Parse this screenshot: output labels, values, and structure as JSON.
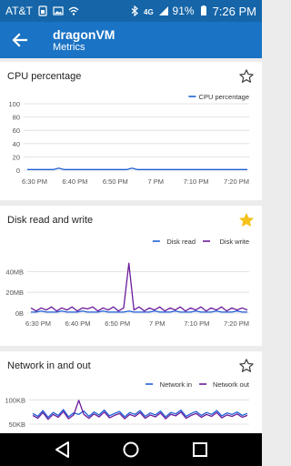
{
  "status_bar": {
    "carrier": "AT&T",
    "battery": "91%",
    "time": "7:26 PM",
    "icons": [
      "sim-icon",
      "image-icon",
      "wifi-icon",
      "bluetooth-icon",
      "4g-icon",
      "signal-icon",
      "battery-icon"
    ]
  },
  "app_bar": {
    "title": "dragonVM",
    "subtitle": "Metrics",
    "back_icon": "arrow-back-icon"
  },
  "cards": {
    "cpu": {
      "title": "CPU percentage",
      "starred": false
    },
    "disk": {
      "title": "Disk read and write",
      "starred": true
    },
    "network": {
      "title": "Network in and out",
      "starred": false
    }
  },
  "colors": {
    "status_bar": "#1565a8",
    "app_bar": "#1a73c4",
    "series_blue": "#1f5fd6",
    "series_purple": "#6a1b9a",
    "star_gold": "#f5c21b",
    "background": "#ececec"
  },
  "chart_data": [
    {
      "id": "cpu",
      "type": "line",
      "title": "CPU percentage",
      "ylim": [
        0,
        100
      ],
      "yticks": [
        "100",
        "80",
        "60",
        "40",
        "20",
        "0"
      ],
      "xticks": [
        "6:30 PM",
        "6:40 PM",
        "6:50 PM",
        "7 PM",
        "7:10 PM",
        "7:20 PM"
      ],
      "legend_position": "top-right",
      "grid": true,
      "series": [
        {
          "name": "CPU percentage",
          "color": "#1f5fd6",
          "values": [
            1,
            1,
            1,
            1,
            1,
            1,
            3,
            1,
            1,
            1,
            1,
            1,
            1,
            1,
            1,
            1,
            1,
            1,
            1,
            1,
            3,
            1,
            1,
            1,
            1,
            1,
            1,
            1,
            1,
            1,
            1,
            1,
            1,
            1,
            1,
            1,
            1,
            1,
            1,
            1,
            1,
            1,
            1
          ]
        }
      ]
    },
    {
      "id": "disk",
      "type": "line",
      "title": "Disk read and write",
      "ylim": [
        0,
        50
      ],
      "yticks": [
        "40MB",
        "20MB",
        "0B"
      ],
      "ytick_values": [
        40,
        20,
        0
      ],
      "xticks": [
        "6:30 PM",
        "6:40 PM",
        "6:50 PM",
        "7 PM",
        "7:10 PM",
        "7:20 PM"
      ],
      "legend_position": "top-right",
      "grid": true,
      "series": [
        {
          "name": "Disk read",
          "color": "#1f5fd6",
          "values": [
            1,
            1,
            2,
            1,
            1,
            1,
            2,
            1,
            1,
            1,
            2,
            1,
            1,
            1,
            2,
            1,
            1,
            1,
            1,
            2,
            1,
            1,
            1,
            1,
            2,
            1,
            1,
            1,
            2,
            1,
            1,
            1,
            2,
            1,
            1,
            1,
            2,
            1,
            1,
            1,
            2,
            1,
            1
          ]
        },
        {
          "name": "Disk write",
          "color": "#6a1b9a",
          "values": [
            5,
            2,
            5,
            3,
            6,
            2,
            5,
            3,
            6,
            2,
            5,
            4,
            6,
            2,
            5,
            3,
            6,
            2,
            5,
            48,
            3,
            6,
            2,
            5,
            3,
            6,
            2,
            5,
            3,
            6,
            2,
            5,
            3,
            6,
            2,
            5,
            3,
            6,
            2,
            5,
            3,
            5,
            3
          ]
        }
      ]
    },
    {
      "id": "network",
      "type": "line",
      "title": "Network in and out",
      "ylim": [
        50,
        110
      ],
      "yticks": [
        "100KB",
        "50KB"
      ],
      "ytick_values": [
        100,
        50
      ],
      "legend_position": "top-right",
      "grid": true,
      "series": [
        {
          "name": "Network in",
          "color": "#1f5fd6",
          "values": [
            72,
            66,
            78,
            64,
            74,
            68,
            80,
            65,
            73,
            70,
            77,
            66,
            75,
            69,
            79,
            67,
            72,
            76,
            65,
            74,
            70,
            78,
            66,
            73,
            69,
            77,
            65,
            74,
            71,
            79,
            66,
            72,
            76,
            68,
            74,
            70,
            78,
            67,
            73,
            70,
            75,
            68,
            72
          ]
        },
        {
          "name": "Network out",
          "color": "#6a1b9a",
          "values": [
            68,
            62,
            74,
            60,
            70,
            64,
            76,
            61,
            69,
            99,
            70,
            62,
            71,
            65,
            75,
            63,
            68,
            72,
            61,
            70,
            66,
            74,
            62,
            69,
            65,
            73,
            61,
            70,
            67,
            75,
            62,
            68,
            72,
            64,
            70,
            66,
            74,
            63,
            69,
            66,
            71,
            64,
            68
          ]
        }
      ]
    }
  ],
  "nav_bar": {
    "icons": [
      "back-triangle-icon",
      "home-circle-icon",
      "recents-square-icon"
    ]
  }
}
